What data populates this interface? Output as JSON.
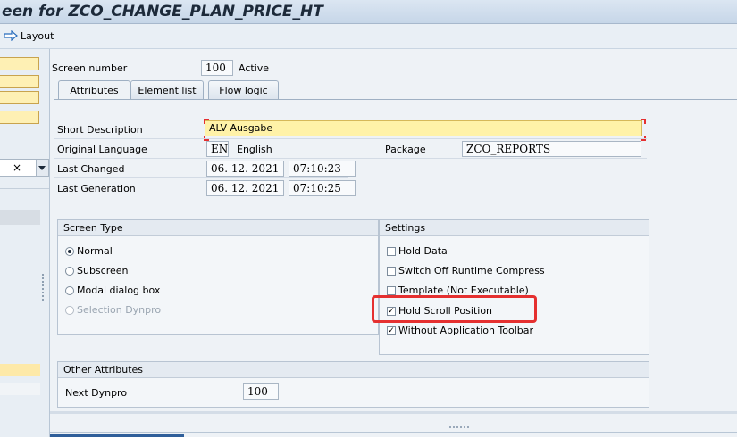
{
  "title": "een for ZCO_CHANGE_PLAN_PRICE_HT",
  "toolbar": {
    "layout_label": "Layout",
    "layout_icon": "arrow-right-icon"
  },
  "left_pane": {
    "dropdown_value": "×"
  },
  "header": {
    "screen_number_label": "Screen number",
    "screen_number": "100",
    "status": "Active"
  },
  "tabs": [
    {
      "label": "Attributes",
      "active": true
    },
    {
      "label": "Element list",
      "active": false
    },
    {
      "label": "Flow logic",
      "active": false
    }
  ],
  "attributes": {
    "short_desc_label": "Short Description",
    "short_desc": "ALV Ausgabe",
    "orig_lang_label": "Original Language",
    "lang_code": "EN",
    "lang_name": "English",
    "package_label": "Package",
    "package": "ZCO_REPORTS",
    "last_changed_label": "Last Changed",
    "last_changed_date": "06. 12. 2021",
    "last_changed_time": "07:10:23",
    "last_gen_label": "Last Generation",
    "last_gen_date": "06. 12. 2021",
    "last_gen_time": "07:10:25"
  },
  "screen_type": {
    "header": "Screen Type",
    "options": [
      {
        "label": "Normal",
        "selected": true,
        "enabled": true
      },
      {
        "label": "Subscreen",
        "selected": false,
        "enabled": true
      },
      {
        "label": "Modal dialog box",
        "selected": false,
        "enabled": true
      },
      {
        "label": "Selection Dynpro",
        "selected": false,
        "enabled": false
      }
    ]
  },
  "settings": {
    "header": "Settings",
    "options": [
      {
        "label": "Hold Data",
        "checked": false
      },
      {
        "label": "Switch Off Runtime Compress",
        "checked": false
      },
      {
        "label": "Template (Not Executable)",
        "checked": false
      },
      {
        "label": "Hold Scroll Position",
        "checked": true
      },
      {
        "label": "Without Application Toolbar",
        "checked": true
      }
    ]
  },
  "other_attributes": {
    "header": "Other Attributes",
    "next_dynpro_label": "Next Dynpro",
    "next_dynpro": "100"
  },
  "colors": {
    "highlight": "#e53030",
    "required_field": "#fef0b4"
  }
}
